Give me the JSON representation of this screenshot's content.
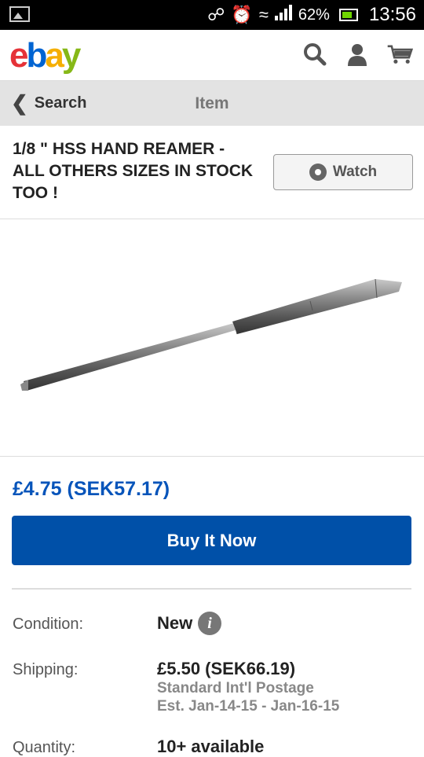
{
  "status_bar": {
    "battery": "62%",
    "time": "13:56"
  },
  "app_bar": {
    "logo_letters": [
      "e",
      "b",
      "a",
      "y"
    ],
    "icons": [
      "search-icon",
      "account-icon",
      "cart-icon"
    ]
  },
  "nav": {
    "back_label": "Search",
    "title": "Item"
  },
  "item": {
    "title": "1/8 \" HSS HAND REAMER - ALL OTHERS SIZES IN STOCK TOO !",
    "watch_label": "Watch",
    "price": "£4.75 (SEK57.17)",
    "buy_label": "Buy It Now"
  },
  "details": {
    "condition_label": "Condition:",
    "condition_value": "New",
    "shipping_label": "Shipping:",
    "shipping_value": "£5.50 (SEK66.19)",
    "shipping_method": "Standard Int'l Postage",
    "shipping_estimate": "Est. Jan-14-15 - Jan-16-15",
    "quantity_label": "Quantity:",
    "quantity_value": "10+ available"
  },
  "colors": {
    "brand_red": "#e53238",
    "brand_blue": "#0064d2",
    "brand_yellow": "#f5af02",
    "brand_green": "#86b817",
    "price_blue": "#0654ba",
    "button_blue": "#0050a8"
  }
}
